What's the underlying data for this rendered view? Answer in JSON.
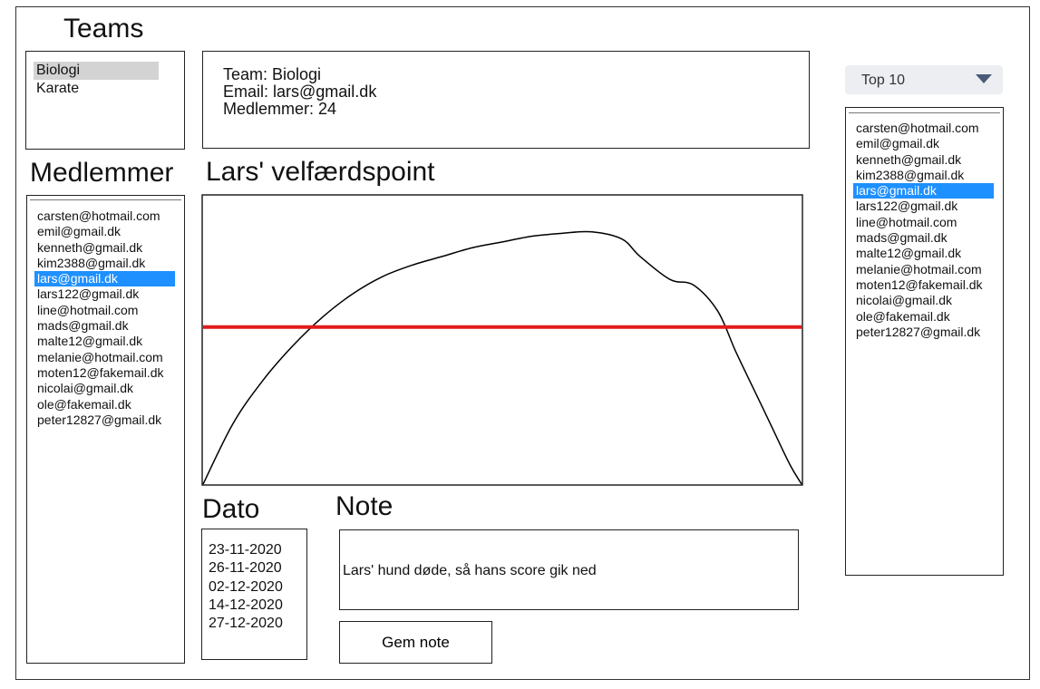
{
  "teams": {
    "heading": "Teams",
    "items": [
      "Biologi",
      "Karate"
    ],
    "selected_index": 0
  },
  "team_info": {
    "team": "Team: Biologi",
    "email": "Email: lars@gmail.dk",
    "members": "Medlemmer: 24"
  },
  "members": {
    "heading": "Medlemmer",
    "items": [
      "carsten@hotmail.com",
      "emil@gmail.dk",
      "kenneth@gmail.dk",
      "kim2388@gmail.dk",
      "lars@gmail.dk",
      "lars122@gmail.dk",
      "line@hotmail.com",
      "mads@gmail.dk",
      "malte12@gmail.dk",
      "melanie@hotmail.com",
      "moten12@fakemail.dk",
      "nicolai@gmail.dk",
      "ole@fakemail.dk",
      "peter12827@gmail.dk"
    ],
    "selected_index": 4
  },
  "chart": {
    "heading": "Lars' velfærdspoint",
    "line_color": "#000000",
    "threshold_color": "#e31b1b"
  },
  "chart_data": {
    "type": "line",
    "title": "Lars' velfærdspoint",
    "xlabel": "",
    "ylabel": "",
    "xlim": [
      0,
      100
    ],
    "ylim": [
      0,
      100
    ],
    "grid": false,
    "series": [
      {
        "x": [
          0,
          5,
          10,
          15,
          20,
          25,
          30,
          35,
          40,
          45,
          50,
          55,
          60,
          65,
          70,
          73,
          78,
          82,
          86,
          89,
          92,
          95,
          98,
          100
        ],
        "y": [
          0,
          21,
          36,
          48,
          58,
          66,
          72,
          76,
          79,
          82,
          84,
          86,
          87,
          87.5,
          85,
          79,
          71,
          69,
          60,
          46,
          33,
          20,
          7,
          0
        ]
      },
      {
        "x": [
          0,
          100
        ],
        "y": [
          54.5,
          54.5
        ]
      }
    ]
  },
  "dates": {
    "heading": "Dato",
    "items": [
      "23-11-2020",
      "26-11-2020",
      "02-12-2020",
      "14-12-2020",
      "27-12-2020"
    ]
  },
  "note": {
    "heading": "Note",
    "text": "Lars' hund døde, så hans score gik ned",
    "save_label": "Gem note"
  },
  "top": {
    "dropdown_value": "Top 10",
    "items": [
      "carsten@hotmail.com",
      "emil@gmail.dk",
      "kenneth@gmail.dk",
      "kim2388@gmail.dk",
      "lars@gmail.dk",
      "lars122@gmail.dk",
      "line@hotmail.com",
      "mads@gmail.dk",
      "malte12@gmail.dk",
      "melanie@hotmail.com",
      "moten12@fakemail.dk",
      "nicolai@gmail.dk",
      "ole@fakemail.dk",
      "peter12827@gmail.dk"
    ],
    "selected_index": 4
  },
  "colors": {
    "selection": "#1e90ff",
    "team_selection": "#d3d3d3"
  }
}
